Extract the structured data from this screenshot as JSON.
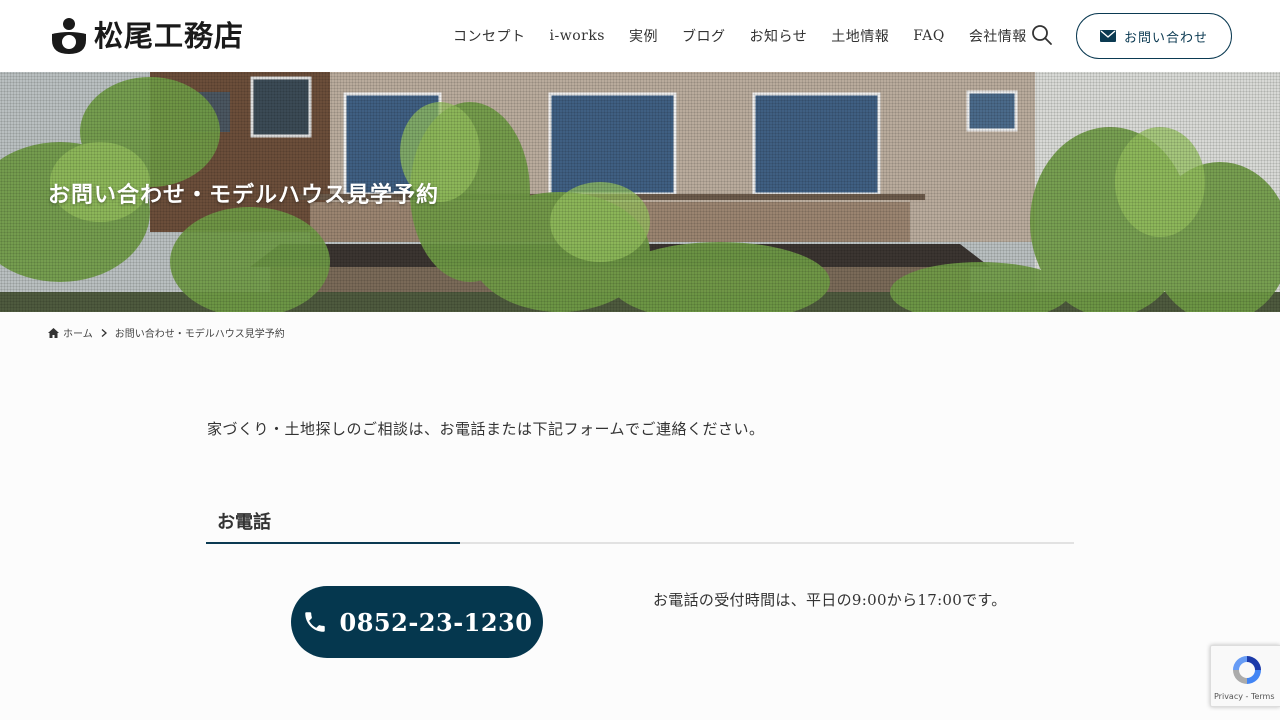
{
  "header": {
    "logo_text": "松尾工務店",
    "nav": [
      "コンセプト",
      "i-works",
      "実例",
      "ブログ",
      "お知らせ",
      "土地情報",
      "FAQ",
      "会社情報"
    ],
    "contact_label": "お問い合わせ"
  },
  "hero": {
    "title": "お問い合わせ・モデルハウス見学予約"
  },
  "breadcrumb": {
    "home": "ホーム",
    "current": "お問い合わせ・モデルハウス見学予約"
  },
  "content": {
    "intro": "家づくり・土地探しのご相談は、お電話または下記フォームでご連絡ください。",
    "phone_section_title": "お電話",
    "phone_number": "0852-23-1230",
    "hours": "お電話の受付時間は、平日の9:00から17:00です。"
  },
  "recaptcha": {
    "links": "Privacy - Terms"
  },
  "colors": {
    "accent": "#05374e",
    "border": "#0b3a52"
  }
}
